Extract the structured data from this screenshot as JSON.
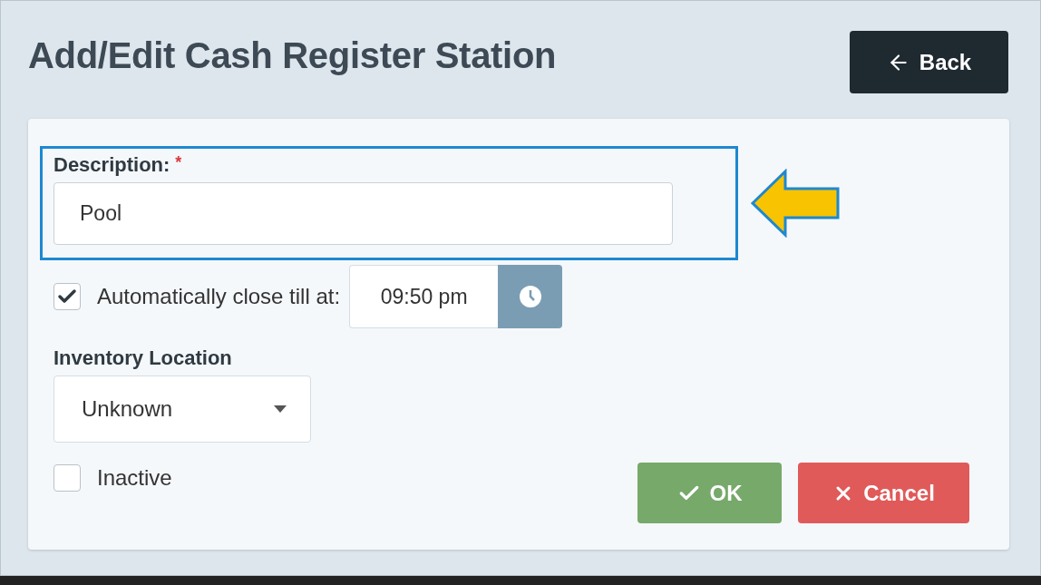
{
  "title": "Add/Edit Cash Register Station",
  "back_button": {
    "label": "Back"
  },
  "description": {
    "label": "Description:",
    "required_mark": "*",
    "value": "Pool",
    "highlighted": true
  },
  "auto_close": {
    "label": "Automatically close till at:",
    "checked": true,
    "time": "09:50 pm"
  },
  "inventory_location": {
    "label": "Inventory Location",
    "value": "Unknown"
  },
  "inactive": {
    "label": "Inactive",
    "checked": false
  },
  "ok_button": {
    "label": "OK"
  },
  "cancel_button": {
    "label": "Cancel"
  }
}
